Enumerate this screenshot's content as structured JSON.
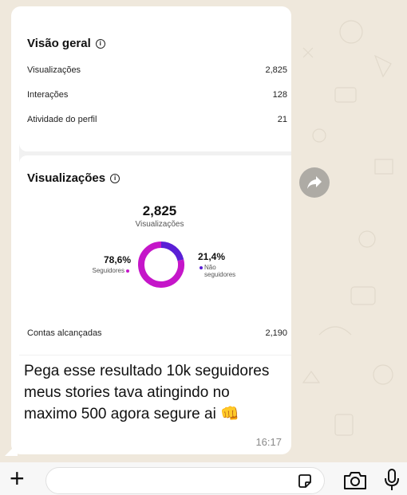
{
  "overview": {
    "title": "Visão geral",
    "rows": [
      {
        "label": "Visualizações",
        "value": "2,825"
      },
      {
        "label": "Interações",
        "value": "128"
      },
      {
        "label": "Atividade do perfil",
        "value": "21"
      }
    ]
  },
  "views": {
    "title": "Visualizações",
    "total": "2,825",
    "total_label": "Visualizações",
    "followers_pct": "78,6%",
    "followers_label": "Seguidores",
    "nonfollowers_pct": "21,4%",
    "nonfollowers_label_1": "Não",
    "nonfollowers_label_2": "seguidores",
    "reached_label": "Contas alcançadas",
    "reached_value": "2,190"
  },
  "chart_data": {
    "type": "pie",
    "categories": [
      "Seguidores",
      "Não seguidores"
    ],
    "values": [
      78.6,
      21.4
    ],
    "colors": [
      "#c516c9",
      "#5a1fd6"
    ]
  },
  "message": {
    "text": "Pega esse resultado 10k seguidores meus stories tava atingindo no maximo 500 agora segure ai",
    "emoji": "👊",
    "time": "16:17"
  },
  "icons": {
    "forward": "forward-arrow-icon",
    "plus": "plus-icon",
    "sticker": "sticker-icon",
    "camera": "camera-icon",
    "mic": "microphone-icon"
  }
}
